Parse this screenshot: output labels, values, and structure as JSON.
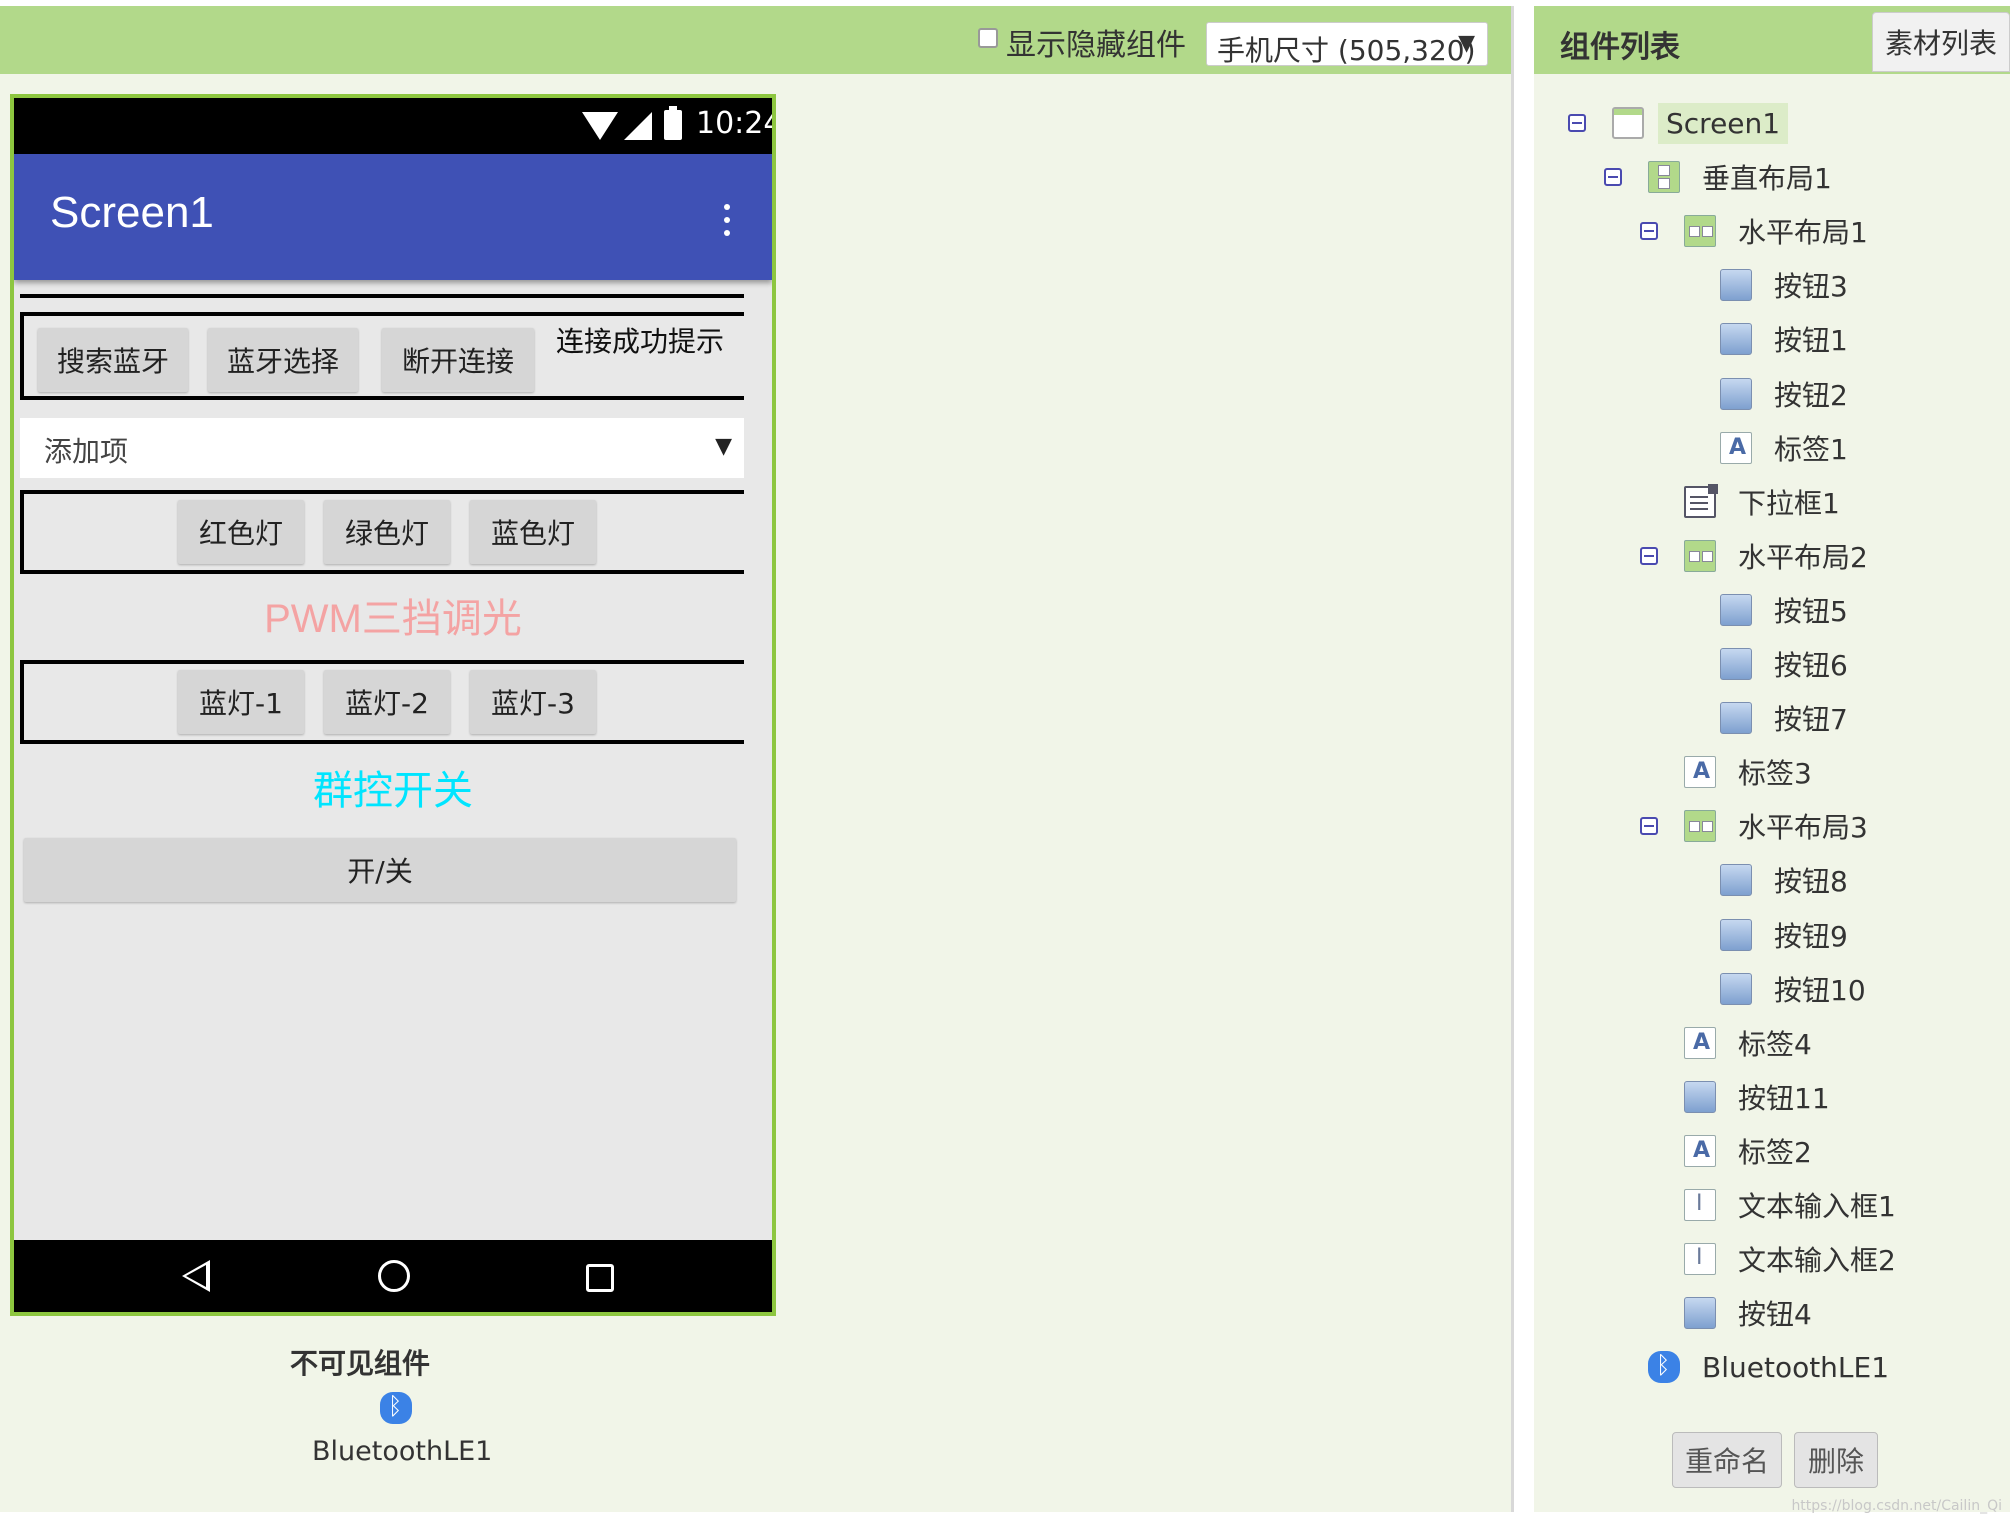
{
  "viewer": {
    "show_hidden_label": "显示隐藏组件",
    "phone_size": "手机尺寸 (505,320)"
  },
  "phone": {
    "status_time": "10:24",
    "title": "Screen1",
    "row1": {
      "buttons": [
        "搜索蓝牙",
        "蓝牙选择",
        "断开连接"
      ],
      "label": "连接成功提示"
    },
    "spinner_text": "添加项",
    "row2": {
      "buttons": [
        "红色灯",
        "绿色灯",
        "蓝色灯"
      ]
    },
    "label_pwm": "PWM三挡调光",
    "row3": {
      "buttons": [
        "蓝灯-1",
        "蓝灯-2",
        "蓝灯-3"
      ]
    },
    "label_group": "群控开关",
    "onoff_button": "开/关"
  },
  "nonvisible": {
    "title": "不可见组件",
    "name": "BluetoothLE1"
  },
  "components": {
    "title": "组件列表",
    "assets_tab": "素材列表",
    "tree": [
      {
        "label": "Screen1",
        "icon": "screen-icon",
        "toggle": true,
        "level": 0,
        "selected": true
      },
      {
        "label": "垂直布局1",
        "icon": "vertical-layout-icon",
        "toggle": true,
        "level": 1
      },
      {
        "label": "水平布局1",
        "icon": "horizontal-layout-icon",
        "toggle": true,
        "level": 2
      },
      {
        "label": "按钮3",
        "icon": "button-icon",
        "level": 3
      },
      {
        "label": "按钮1",
        "icon": "button-icon",
        "level": 3
      },
      {
        "label": "按钮2",
        "icon": "button-icon",
        "level": 3
      },
      {
        "label": "标签1",
        "icon": "label-icon",
        "level": 3
      },
      {
        "label": "下拉框1",
        "icon": "spinner-icon",
        "level": 2
      },
      {
        "label": "水平布局2",
        "icon": "horizontal-layout-icon",
        "toggle": true,
        "level": 2
      },
      {
        "label": "按钮5",
        "icon": "button-icon",
        "level": 3
      },
      {
        "label": "按钮6",
        "icon": "button-icon",
        "level": 3
      },
      {
        "label": "按钮7",
        "icon": "button-icon",
        "level": 3
      },
      {
        "label": "标签3",
        "icon": "label-icon",
        "level": 2
      },
      {
        "label": "水平布局3",
        "icon": "horizontal-layout-icon",
        "toggle": true,
        "level": 2
      },
      {
        "label": "按钮8",
        "icon": "button-icon",
        "level": 3
      },
      {
        "label": "按钮9",
        "icon": "button-icon",
        "level": 3
      },
      {
        "label": "按钮10",
        "icon": "button-icon",
        "level": 3
      },
      {
        "label": "标签4",
        "icon": "label-icon",
        "level": 2
      },
      {
        "label": "按钮11",
        "icon": "button-icon",
        "level": 2
      },
      {
        "label": "标签2",
        "icon": "label-icon",
        "level": 2
      },
      {
        "label": "文本输入框1",
        "icon": "textbox-icon",
        "level": 2
      },
      {
        "label": "文本输入框2",
        "icon": "textbox-icon",
        "level": 2
      },
      {
        "label": "按钮4",
        "icon": "button-icon",
        "level": 2
      },
      {
        "label": "BluetoothLE1",
        "icon": "bluetooth-icon",
        "level": 1
      }
    ],
    "rename_button": "重命名",
    "delete_button": "删除"
  },
  "colors": {
    "toolbar_green": "#b2d98a",
    "panel_bg": "#f1f5e8",
    "appbar_blue": "#3f51b5",
    "phone_border": "#8dc63f",
    "pwm_label": "#f4a3a3",
    "group_label": "#00e5ff"
  },
  "watermark": "https://blog.csdn.net/Cailin_Qi"
}
